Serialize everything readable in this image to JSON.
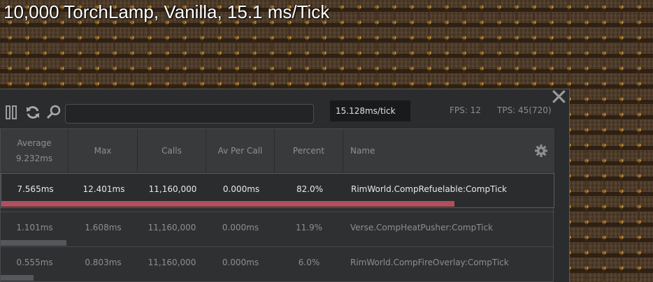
{
  "title": "10,000 TorchLamp, Vanilla, 15.1 ms/Tick",
  "toolbar": {
    "search_value": "",
    "tick_label": "15.128ms/tick",
    "fps_label": "FPS: 12",
    "tps_label": "TPS: 45(720)",
    "close_glyph": "✕"
  },
  "table": {
    "headers": {
      "average": "Average",
      "average_total": "9.232ms",
      "max": "Max",
      "calls": "Calls",
      "av_per_call": "Av Per Call",
      "percent": "Percent",
      "name": "Name"
    },
    "rows": [
      {
        "average": "7.565ms",
        "max": "12.401ms",
        "calls": "11,160,000",
        "av_per_call": "0.000ms",
        "percent": "82.0%",
        "name": "RimWorld.CompRefuelable:CompTick",
        "bar_fraction": 0.82,
        "selected": true
      },
      {
        "average": "1.101ms",
        "max": "1.608ms",
        "calls": "11,160,000",
        "av_per_call": "0.000ms",
        "percent": "11.9%",
        "name": "Verse.CompHeatPusher:CompTick",
        "bar_fraction": 0.119,
        "selected": false
      },
      {
        "average": "0.555ms",
        "max": "0.803ms",
        "calls": "11,160,000",
        "av_per_call": "0.000ms",
        "percent": "6.0%",
        "name": "RimWorld.CompFireOverlay:CompTick",
        "bar_fraction": 0.06,
        "selected": false
      }
    ]
  },
  "colors": {
    "bar_selected": "#b0505c",
    "bar_normal": "#55575a",
    "text_selected": "#e8e8e8",
    "text_normal": "#8d8e90"
  },
  "icons": [
    "pause-icon",
    "refresh-icon",
    "search-icon",
    "gear-icon",
    "close-icon"
  ]
}
